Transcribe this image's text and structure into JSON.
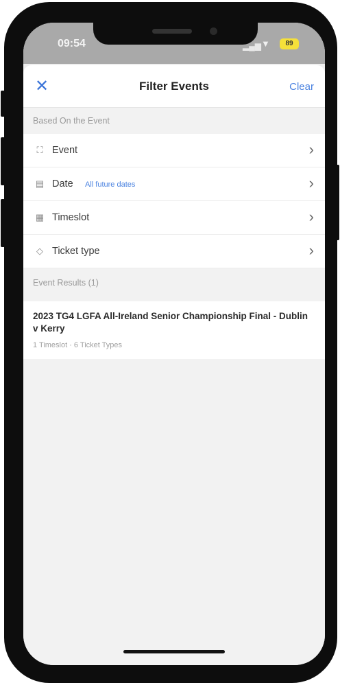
{
  "status_bar": {
    "time": "09:54",
    "battery": "89"
  },
  "nav": {
    "close_icon": "close-icon",
    "title": "Filter Events",
    "clear_label": "Clear"
  },
  "sections": {
    "based_on": "Based On the Event",
    "results": "Event Results (1)"
  },
  "filters": [
    {
      "label": "Event",
      "icon": "event-icon",
      "value": ""
    },
    {
      "label": "Date",
      "icon": "calendar-icon",
      "value": "All future dates"
    },
    {
      "label": "Timeslot",
      "icon": "timeslot-icon",
      "value": ""
    },
    {
      "label": "Ticket type",
      "icon": "tag-icon",
      "value": ""
    }
  ],
  "result": {
    "title": "2023 TG4 LGFA All-Ireland Senior Championship Final - Dublin v Kerry",
    "subtitle": "1 Timeslot · 6 Ticket Types"
  },
  "colors": {
    "accent": "#4a82e0",
    "status_bar": "#a9a9a9",
    "battery": "#f5e03a"
  }
}
